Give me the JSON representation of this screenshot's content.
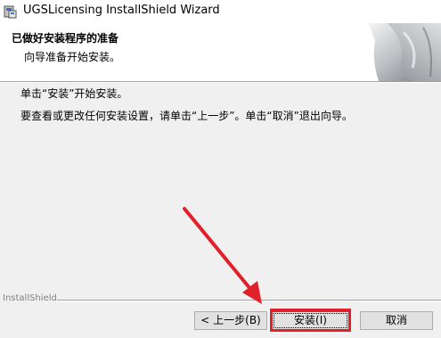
{
  "window": {
    "title": "UGSLicensing InstallShield Wizard"
  },
  "header": {
    "title": "已做好安装程序的准备",
    "subtitle": "向导准备开始安装。"
  },
  "content": {
    "line1": "单击“安装”开始安装。",
    "line2": "要查看或更改任何安装设置，请单击“上一步”。单击“取消”退出向导。"
  },
  "footer": {
    "brand": "InstallShield"
  },
  "buttons": {
    "back": "< 上一步(B)",
    "install": "安装(I)",
    "cancel": "取消"
  },
  "annotation": {
    "color": "#e0202a"
  }
}
